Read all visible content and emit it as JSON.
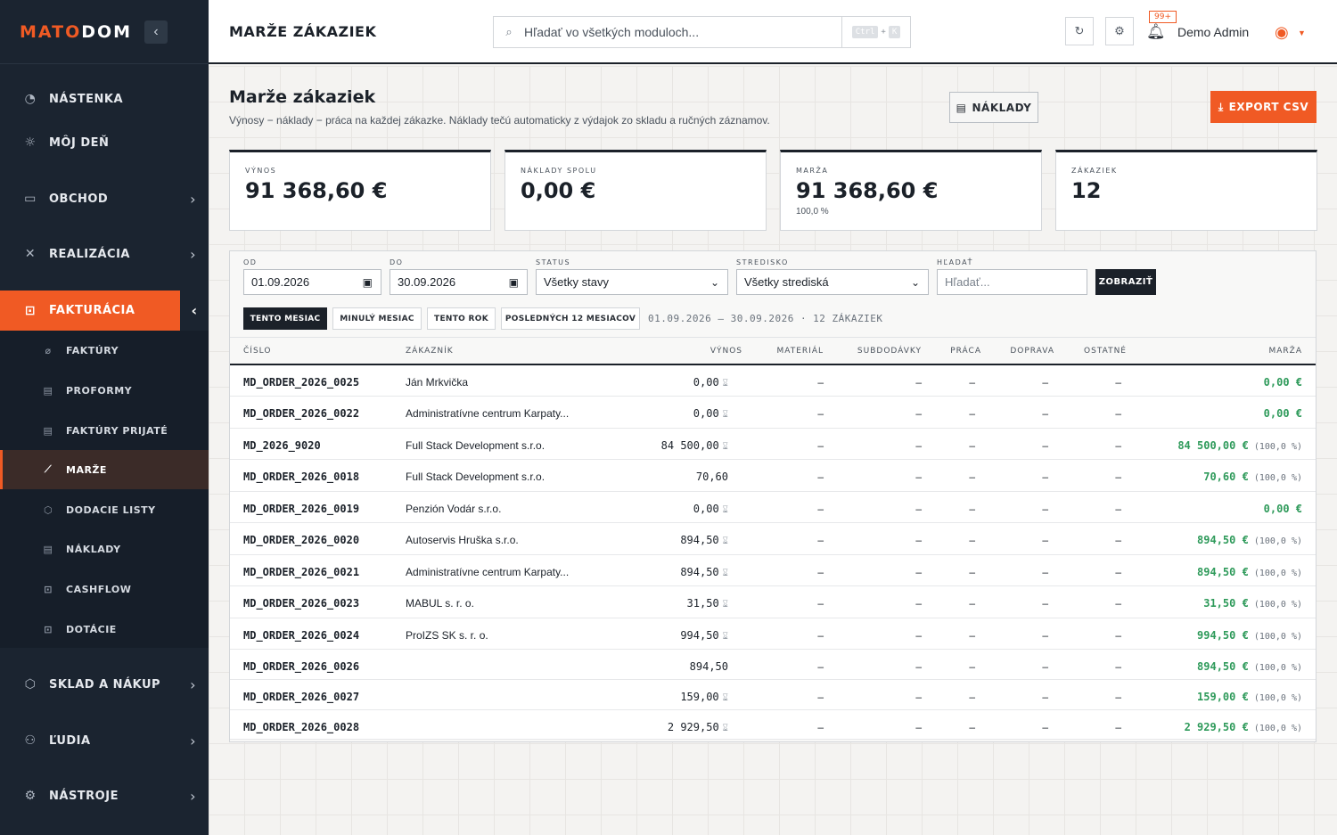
{
  "sidebar": {
    "logo_part1": "MATO",
    "logo_part2": "DOM",
    "items": [
      {
        "label": "NÁSTENKA",
        "icon": "dashboard-icon"
      },
      {
        "label": "MÔJ DEŇ",
        "icon": "sun-icon"
      },
      {
        "label": "OBCHOD",
        "icon": "briefcase-icon"
      },
      {
        "label": "REALIZÁCIA",
        "icon": "tools-icon"
      },
      {
        "label": "FAKTURÁCIA",
        "icon": "invoice-icon"
      },
      {
        "label": "SKLAD A NÁKUP",
        "icon": "box-icon"
      },
      {
        "label": "ĽUDIA",
        "icon": "people-icon"
      },
      {
        "label": "NÁSTROJE",
        "icon": "gear-icon"
      }
    ],
    "sub_items": [
      {
        "label": "FAKTÚRY",
        "icon": "link-icon"
      },
      {
        "label": "PROFORMY",
        "icon": "document-icon"
      },
      {
        "label": "FAKTÚRY PRIJATÉ",
        "icon": "document-icon"
      },
      {
        "label": "MARŽE",
        "icon": "chart-icon"
      },
      {
        "label": "DODACIE LISTY",
        "icon": "package-icon"
      },
      {
        "label": "NÁKLADY",
        "icon": "receipt-icon"
      },
      {
        "label": "CASHFLOW",
        "icon": "cash-icon"
      },
      {
        "label": "DOTÁCIE",
        "icon": "cash-icon"
      }
    ]
  },
  "topbar": {
    "page_title": "MARŽE ZÁKAZIEK",
    "search_placeholder": "Hľadať vo všetkých moduloch...",
    "kbd_ctrl": "Ctrl",
    "kbd_plus": "+",
    "kbd_k": "K",
    "notifications_badge": "99+",
    "user_name": "Demo Admin"
  },
  "page": {
    "title": "Marže zákaziek",
    "subtitle": "Výnosy − náklady − práca na každej zákazke. Náklady tečú automaticky z výdajok zo skladu a ručných záznamov.",
    "costs_button": "NÁKLADY",
    "export_button": "EXPORT CSV"
  },
  "kpis": [
    {
      "label": "VÝNOS",
      "value": "91 368,60 €",
      "sub": ""
    },
    {
      "label": "NÁKLADY SPOLU",
      "value": "0,00 €",
      "sub": ""
    },
    {
      "label": "MARŽA",
      "value": "91 368,60 €",
      "sub": "100,0 %"
    },
    {
      "label": "ZÁKAZIEK",
      "value": "12",
      "sub": ""
    }
  ],
  "filters": {
    "from_label": "OD",
    "from_value": "01.09.2026",
    "to_label": "DO",
    "to_value": "30.09.2026",
    "status_label": "STATUS",
    "status_value": "Všetky stavy",
    "center_label": "STREDISKO",
    "center_value": "Všetky strediská",
    "search_label": "HĽADAŤ",
    "search_placeholder": "Hľadať...",
    "show_button": "ZOBRAZIŤ",
    "presets": [
      "TENTO MESIAC",
      "MINULÝ MESIAC",
      "TENTO ROK",
      "POSLEDNÝCH 12 MESIACOV"
    ],
    "range_info": "01.09.2026 – 30.09.2026 · 12 ZÁKAZIEK"
  },
  "table": {
    "columns": [
      "ČÍSLO",
      "ZÁKAZNÍK",
      "VÝNOS",
      "MATERIÁL",
      "SUBDODÁVKY",
      "PRÁCA",
      "DOPRAVA",
      "OSTATNÉ",
      "MARŽA"
    ],
    "rows": [
      {
        "number": "MD_ORDER_2026_0025",
        "customer": "Ján Mrkvička",
        "revenue": "0,00",
        "pending": true,
        "material": "–",
        "subcontract": "–",
        "labor": "–",
        "transport": "–",
        "other": "–",
        "margin": "0,00 €",
        "margin_pct": ""
      },
      {
        "number": "MD_ORDER_2026_0022",
        "customer": "Administratívne centrum Karpaty...",
        "revenue": "0,00",
        "pending": true,
        "material": "–",
        "subcontract": "–",
        "labor": "–",
        "transport": "–",
        "other": "–",
        "margin": "0,00 €",
        "margin_pct": ""
      },
      {
        "number": "MD_2026_9020",
        "customer": "Full Stack Development s.r.o.",
        "revenue": "84 500,00",
        "pending": true,
        "material": "–",
        "subcontract": "–",
        "labor": "–",
        "transport": "–",
        "other": "–",
        "margin": "84 500,00 €",
        "margin_pct": "(100,0 %)"
      },
      {
        "number": "MD_ORDER_2026_0018",
        "customer": "Full Stack Development s.r.o.",
        "revenue": "70,60",
        "pending": false,
        "material": "–",
        "subcontract": "–",
        "labor": "–",
        "transport": "–",
        "other": "–",
        "margin": "70,60 €",
        "margin_pct": "(100,0 %)"
      },
      {
        "number": "MD_ORDER_2026_0019",
        "customer": "Penzión Vodár s.r.o.",
        "revenue": "0,00",
        "pending": true,
        "material": "–",
        "subcontract": "–",
        "labor": "–",
        "transport": "–",
        "other": "–",
        "margin": "0,00 €",
        "margin_pct": ""
      },
      {
        "number": "MD_ORDER_2026_0020",
        "customer": "Autoservis Hruška s.r.o.",
        "revenue": "894,50",
        "pending": true,
        "material": "–",
        "subcontract": "–",
        "labor": "–",
        "transport": "–",
        "other": "–",
        "margin": "894,50 €",
        "margin_pct": "(100,0 %)"
      },
      {
        "number": "MD_ORDER_2026_0021",
        "customer": "Administratívne centrum Karpaty...",
        "revenue": "894,50",
        "pending": true,
        "material": "–",
        "subcontract": "–",
        "labor": "–",
        "transport": "–",
        "other": "–",
        "margin": "894,50 €",
        "margin_pct": "(100,0 %)"
      },
      {
        "number": "MD_ORDER_2026_0023",
        "customer": "MABUL s. r. o.",
        "revenue": "31,50",
        "pending": true,
        "material": "–",
        "subcontract": "–",
        "labor": "–",
        "transport": "–",
        "other": "–",
        "margin": "31,50 €",
        "margin_pct": "(100,0 %)"
      },
      {
        "number": "MD_ORDER_2026_0024",
        "customer": "ProIZS SK s. r. o.",
        "revenue": "994,50",
        "pending": true,
        "material": "–",
        "subcontract": "–",
        "labor": "–",
        "transport": "–",
        "other": "–",
        "margin": "994,50 €",
        "margin_pct": "(100,0 %)"
      },
      {
        "number": "MD_ORDER_2026_0026",
        "customer": "",
        "revenue": "894,50",
        "pending": false,
        "material": "–",
        "subcontract": "–",
        "labor": "–",
        "transport": "–",
        "other": "–",
        "margin": "894,50 €",
        "margin_pct": "(100,0 %)"
      },
      {
        "number": "MD_ORDER_2026_0027",
        "customer": "",
        "revenue": "159,00",
        "pending": true,
        "material": "–",
        "subcontract": "–",
        "labor": "–",
        "transport": "–",
        "other": "–",
        "margin": "159,00 €",
        "margin_pct": "(100,0 %)"
      },
      {
        "number": "MD_ORDER_2026_0028",
        "customer": "",
        "revenue": "2 929,50",
        "pending": true,
        "material": "–",
        "subcontract": "–",
        "labor": "–",
        "transport": "–",
        "other": "–",
        "margin": "2 929,50 €",
        "margin_pct": "(100,0 %)"
      }
    ]
  },
  "colors": {
    "accent": "#f05a24",
    "sidebar": "#1b2430",
    "margin_positive": "#2e9a5a"
  }
}
